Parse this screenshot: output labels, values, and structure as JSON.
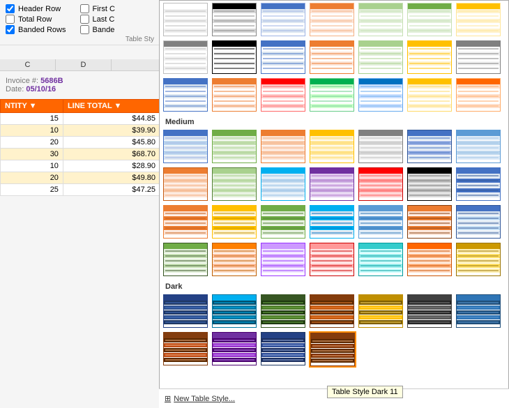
{
  "leftPanel": {
    "checkboxes": [
      {
        "id": "header-row",
        "label": "Header Row",
        "checked": true
      },
      {
        "id": "total-row",
        "label": "Total Row",
        "checked": false
      },
      {
        "id": "banded-rows",
        "label": "Banded Rows",
        "checked": true
      },
      {
        "id": "first-col",
        "label": "First C",
        "checked": false
      },
      {
        "id": "last-col",
        "label": "Last C",
        "checked": false
      },
      {
        "id": "banded-cols",
        "label": "Bande",
        "checked": false
      }
    ],
    "tableStyleLabel": "Table Sty",
    "spreadsheet": {
      "colHeaders": [
        "C",
        "D"
      ],
      "invoiceNumber": "5686B",
      "invoiceDate": "05/10/16",
      "tableHeaders": [
        "NTITY",
        "LINE TOTAL"
      ],
      "rows": [
        {
          "qty": 15,
          "total": "$44.85"
        },
        {
          "qty": 10,
          "total": "$39.90"
        },
        {
          "qty": 20,
          "total": "$45.80"
        },
        {
          "qty": 30,
          "total": "$68.70"
        },
        {
          "qty": 10,
          "total": "$28.90"
        },
        {
          "qty": 20,
          "total": "$49.80"
        },
        {
          "qty": 25,
          "total": "$47.25"
        }
      ]
    }
  },
  "dropdown": {
    "sections": [
      {
        "id": "light",
        "label": "",
        "styles": 21
      },
      {
        "id": "medium",
        "label": "Medium",
        "styles": 28
      },
      {
        "id": "dark",
        "label": "Dark",
        "styles": 11
      }
    ],
    "tooltip": "Table Style Dark 11",
    "tooltipX": 470,
    "tooltipY": 558,
    "bottomButton": "New Table Style..."
  }
}
